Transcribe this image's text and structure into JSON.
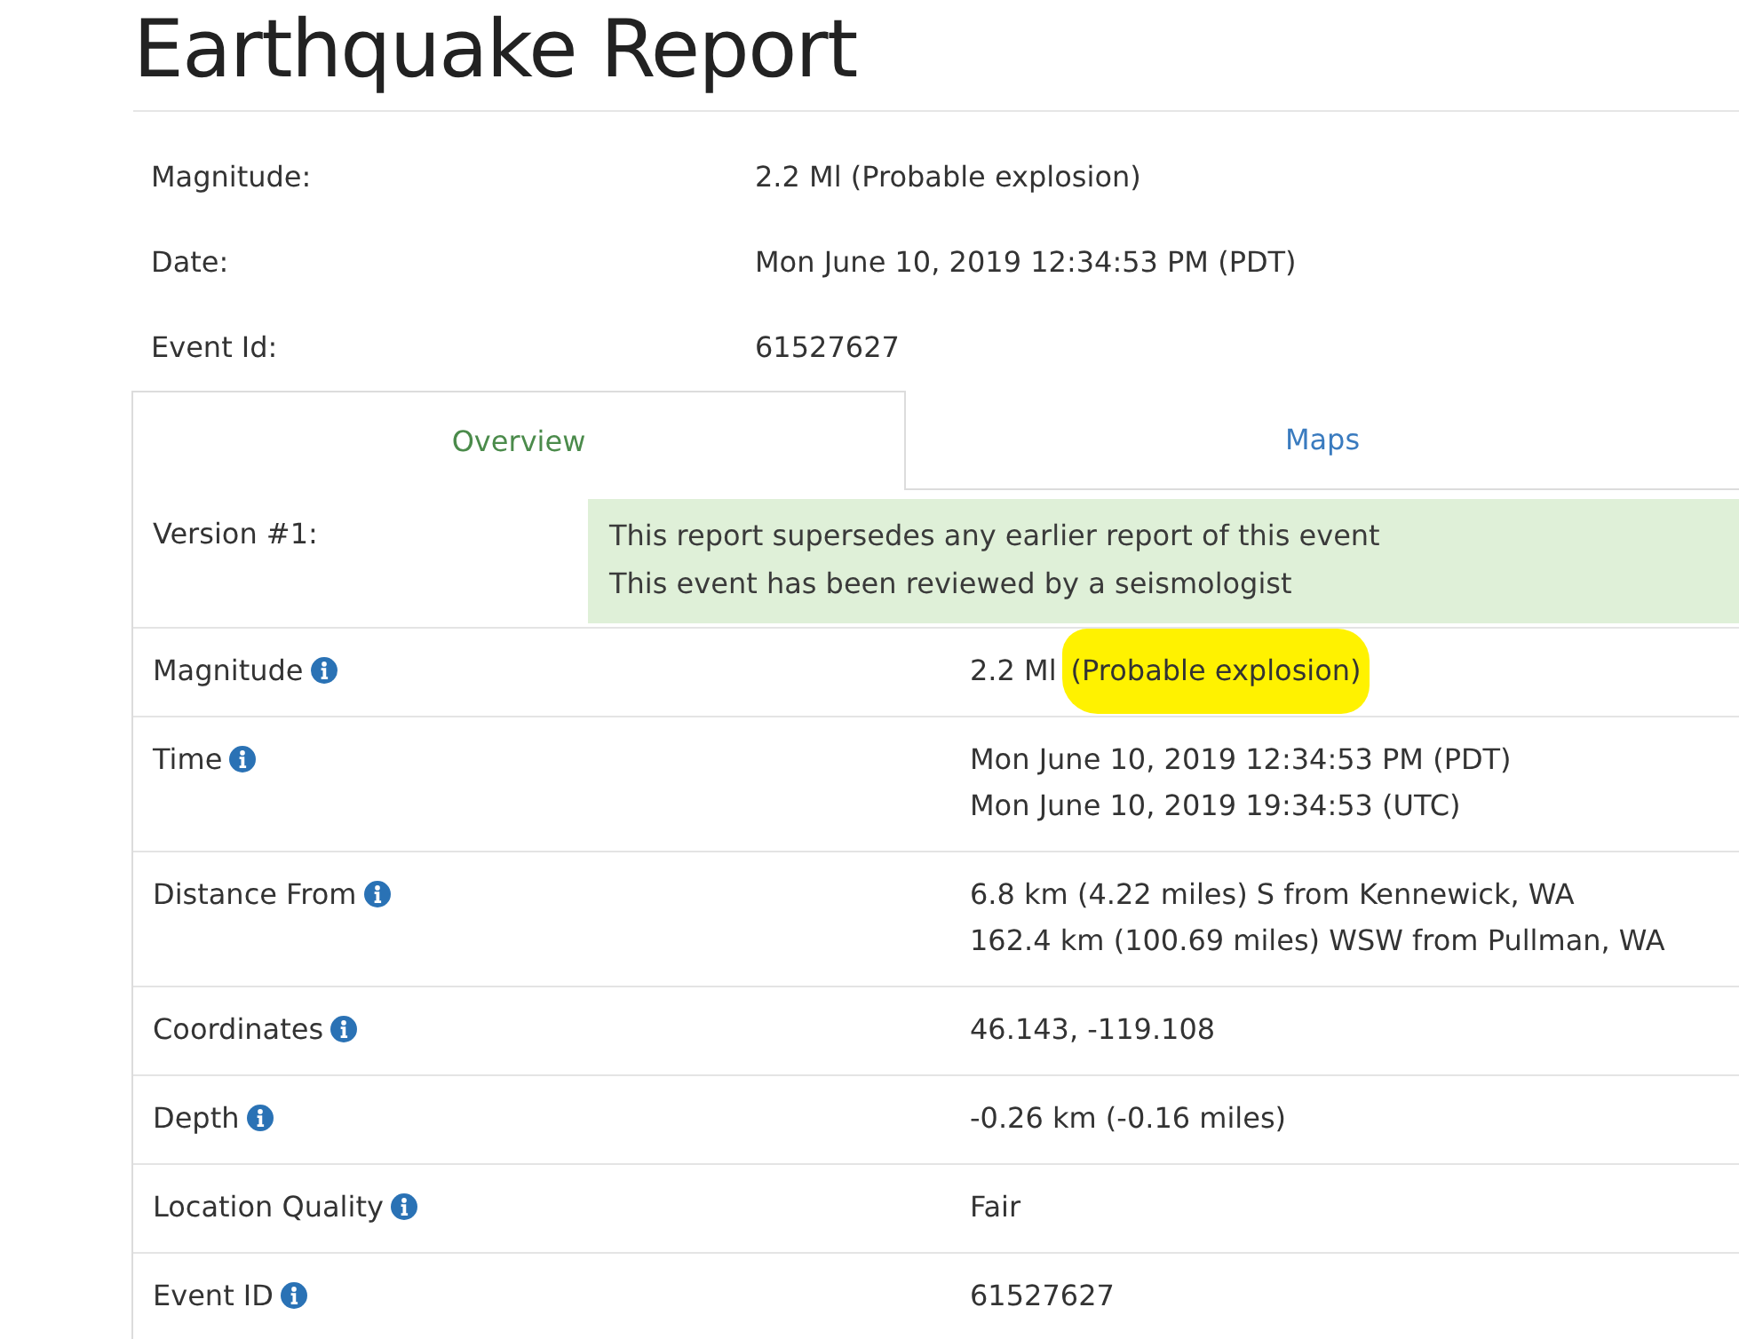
{
  "title": "Earthquake Report",
  "summary": [
    {
      "label": "Magnitude:",
      "value": "2.2 Ml (Probable explosion)"
    },
    {
      "label": "Date:",
      "value": "Mon June 10, 2019 12:34:53 PM (PDT)"
    },
    {
      "label": "Event Id:",
      "value": "61527627"
    }
  ],
  "tabs": [
    {
      "label": "Overview",
      "selected": true
    },
    {
      "label": "Maps",
      "selected": false
    }
  ],
  "details": [
    {
      "kind": "notice",
      "label": "Version #1:",
      "info_icon": false,
      "lines": [
        "This report supersedes any earlier report of this event",
        "This event has been reviewed by a seismologist"
      ]
    },
    {
      "kind": "field",
      "label": "Magnitude",
      "info_icon": true,
      "lines": [
        "2.2 Ml"
      ],
      "highlight": "(Probable explosion)"
    },
    {
      "kind": "field",
      "label": "Time",
      "info_icon": true,
      "lines": [
        "Mon June 10, 2019 12:34:53 PM (PDT)",
        "Mon June 10, 2019 19:34:53 (UTC)"
      ]
    },
    {
      "kind": "field",
      "label": "Distance From",
      "info_icon": true,
      "lines": [
        "6.8 km (4.22 miles) S from Kennewick, WA",
        "162.4 km (100.69 miles) WSW from Pullman, WA"
      ]
    },
    {
      "kind": "field",
      "label": "Coordinates",
      "info_icon": true,
      "lines": [
        "46.143, -119.108"
      ]
    },
    {
      "kind": "field",
      "label": "Depth",
      "info_icon": true,
      "lines": [
        "-0.26 km (-0.16 miles)"
      ]
    },
    {
      "kind": "field",
      "label": "Location Quality",
      "info_icon": true,
      "lines": [
        "Fair"
      ]
    },
    {
      "kind": "field",
      "label": "Event ID",
      "info_icon": true,
      "lines": [
        "61527627"
      ]
    }
  ]
}
